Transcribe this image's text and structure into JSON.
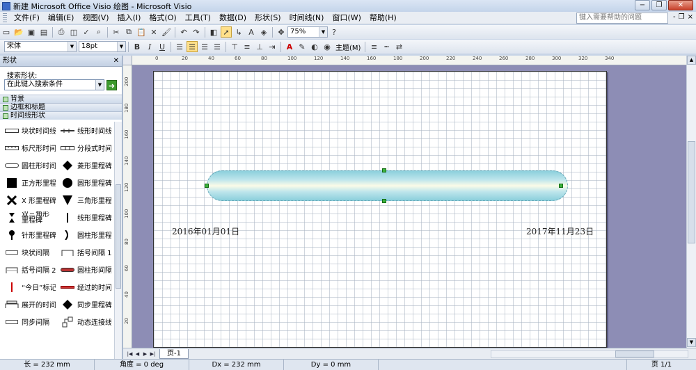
{
  "window": {
    "title": "新建 Microsoft Office Visio 绘图 - Microsoft Visio",
    "minimize": "−",
    "maximize": "❐",
    "close": "✕"
  },
  "menu": {
    "items": [
      "文件(F)",
      "编辑(E)",
      "视图(V)",
      "插入(I)",
      "格式(O)",
      "工具(T)",
      "数据(D)",
      "形状(S)",
      "时间线(N)",
      "窗口(W)",
      "帮助(H)"
    ],
    "help_placeholder": "键入需要帮助的问题",
    "mdi_min": "-",
    "mdi_restore": "❐",
    "mdi_close": "×"
  },
  "toolbar1": {
    "zoom": "75%"
  },
  "toolbar2": {
    "font": "宋体",
    "font_size": "18pt",
    "theme_label": "主题(M)"
  },
  "shapes_panel": {
    "title": "形状",
    "search_label": "搜索形状:",
    "search_placeholder": "在此键入搜索条件",
    "stencils": [
      "背景",
      "边框和标题",
      "时间线形状"
    ],
    "shapes": [
      {
        "label": "块状时间线",
        "icon": "block-timeline-icon"
      },
      {
        "label": "线形时间线",
        "icon": "line-timeline-icon"
      },
      {
        "label": "标尺形时间线",
        "icon": "ruler-timeline-icon"
      },
      {
        "label": "分段式时间线",
        "icon": "segmented-timeline-icon"
      },
      {
        "label": "圆柱形时间线",
        "icon": "cylinder-timeline-icon"
      },
      {
        "label": "菱形里程碑",
        "icon": "diamond-milestone-icon"
      },
      {
        "label": "正方形里程碑",
        "icon": "square-milestone-icon"
      },
      {
        "label": "圆形里程碑",
        "icon": "circle-milestone-icon"
      },
      {
        "label": "X 形里程碑",
        "icon": "x-milestone-icon"
      },
      {
        "label": "三角形里程碑",
        "icon": "triangle-milestone-icon"
      },
      {
        "label": "双三角形里程碑",
        "icon": "double-triangle-milestone-icon"
      },
      {
        "label": "线形里程碑",
        "icon": "line-milestone-icon"
      },
      {
        "label": "针形里程碑",
        "icon": "pin-milestone-icon"
      },
      {
        "label": "圆柱形里程碑",
        "icon": "cylinder-milestone-icon"
      },
      {
        "label": "块状间隔",
        "icon": "block-interval-icon"
      },
      {
        "label": "括号间隔 1",
        "icon": "bracket-interval-1-icon"
      },
      {
        "label": "括号间隔 2",
        "icon": "bracket-interval-2-icon"
      },
      {
        "label": "圆柱形间隔",
        "icon": "cylinder-interval-icon"
      },
      {
        "label": "“今日”标记",
        "icon": "today-marker-icon"
      },
      {
        "label": "经过的时间",
        "icon": "elapsed-time-icon"
      },
      {
        "label": "展开的时间线",
        "icon": "expanded-timeline-icon"
      },
      {
        "label": "同步里程碑",
        "icon": "sync-milestone-icon"
      },
      {
        "label": "同步间隔",
        "icon": "sync-interval-icon"
      },
      {
        "label": "动态连接线",
        "icon": "dynamic-connector-icon"
      }
    ]
  },
  "ruler": {
    "h_labels": [
      "0",
      "20",
      "40",
      "60",
      "80",
      "100",
      "120",
      "140",
      "160",
      "180",
      "200",
      "220",
      "240",
      "260",
      "280",
      "300",
      "320",
      "340"
    ],
    "v_labels": [
      "200",
      "180",
      "160",
      "140",
      "120",
      "100",
      "80",
      "60",
      "40",
      "20"
    ]
  },
  "drawing": {
    "start_date": "2016年01月01日",
    "end_date": "2017年11月23日"
  },
  "pages": {
    "tab": "页-1"
  },
  "status": {
    "length": "长 = 232 mm",
    "angle": "角度 = 0 deg",
    "dx": "Dx = 232 mm",
    "dy": "Dy = 0 mm",
    "page": "页 1/1"
  },
  "colors": {
    "timeline_fill": "#bfe6ec",
    "canvas_background": "#8d8db5",
    "handle": "#3db23d"
  }
}
